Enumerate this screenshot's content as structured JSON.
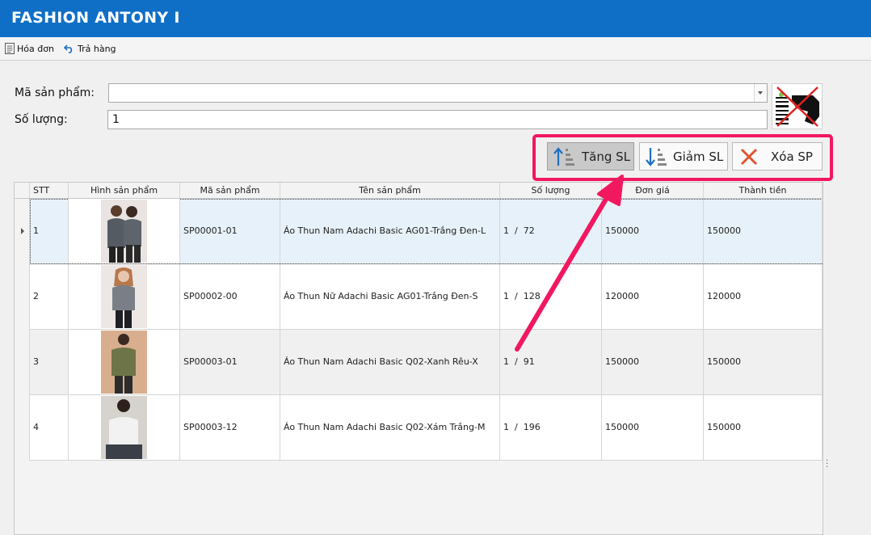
{
  "app": {
    "title": "FASHION ANTONY I"
  },
  "tabs": [
    {
      "label": "Hóa đơn",
      "icon": "invoice-icon"
    },
    {
      "label": "Trả hàng",
      "icon": "undo-icon"
    }
  ],
  "form": {
    "product_code_label": "Mã sản phẩm:",
    "product_code_value": "",
    "quantity_label": "Số lượng:",
    "quantity_value": "1"
  },
  "actions": {
    "increase_label": "Tăng SL",
    "decrease_label": "Giảm SL",
    "delete_label": "Xóa SP",
    "accent": "#f2185f"
  },
  "table": {
    "columns": [
      "STT",
      "Hình sản phẩm",
      "Mã sản phẩm",
      "Tên sản phẩm",
      "Số lượng",
      "Đơn giá",
      "Thành tiền"
    ],
    "rows": [
      {
        "stt": "1",
        "code": "SP00001-01",
        "name": "Áo Thun Nam Adachi Basic AG01-Trắng Đen-L",
        "qty": "1  /  72",
        "price": "150000",
        "total": "150000"
      },
      {
        "stt": "2",
        "code": "SP00002-00",
        "name": "Áo Thun Nữ Adachi Basic AG01-Trắng Đen-S",
        "qty": "1  /  128",
        "price": "120000",
        "total": "120000"
      },
      {
        "stt": "3",
        "code": "SP00003-01",
        "name": "Áo Thun Nam Adachi Basic Q02-Xanh Rêu-X",
        "qty": "1  /  91",
        "price": "150000",
        "total": "150000"
      },
      {
        "stt": "4",
        "code": "SP00003-12",
        "name": "Áo Thun Nam Adachi Basic Q02-Xám Trắng-M",
        "qty": "1  /  196",
        "price": "150000",
        "total": "150000"
      }
    ]
  }
}
